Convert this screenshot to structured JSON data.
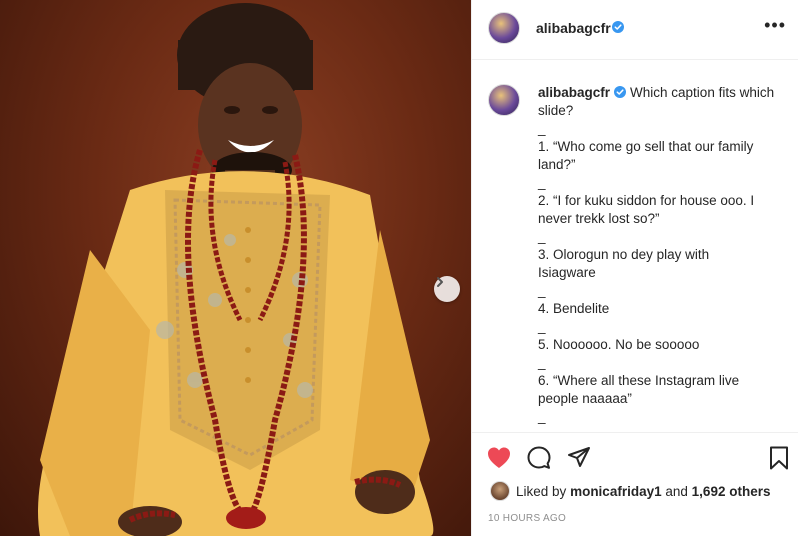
{
  "post": {
    "username": "alibabagcfr",
    "verified": true,
    "caption_lines": [
      "Which caption fits which",
      "slide?",
      "_",
      "1. “Who come go sell that our family",
      "land?”",
      "_",
      "2. “I for kuku siddon for house ooo. I",
      "never trekk lost so?”",
      "_",
      "3. Olorogun no dey play with",
      "Isiagware",
      "_",
      "4. Bendelite",
      "_",
      "5. Noooooo. No be sooooo",
      "_",
      "6. “Where all these Instagram live",
      "people naaaaa”",
      "_"
    ],
    "liked_by_prefix": "Liked by",
    "liked_by_user": "monicafriday1",
    "liked_by_and": "and",
    "liked_by_others": "1,692 others",
    "time_ago": "10 HOURS AGO"
  },
  "icons": {
    "more": "more-options-icon",
    "next": "chevron-right-icon",
    "like": "heart-icon",
    "comment": "comment-icon",
    "share": "send-icon",
    "save": "bookmark-icon",
    "verified": "verified-badge-icon"
  },
  "colors": {
    "like_red": "#ed4956",
    "verified_blue": "#3897f0",
    "border": "#efefef",
    "muted": "#8e8e8e"
  }
}
